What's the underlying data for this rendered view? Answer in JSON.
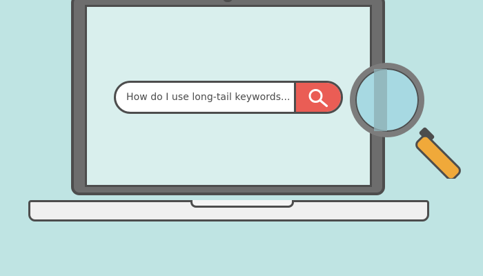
{
  "search": {
    "query_text": "How do I use long-tail keywords...",
    "button_icon": "search-icon"
  },
  "illustration": {
    "objects": [
      "laptop",
      "search bar",
      "magnifying glass"
    ]
  },
  "colors": {
    "background": "#bfe4e3",
    "screen": "#d9efed",
    "laptop_outline": "#4d4d4d",
    "laptop_frame": "#6d6d6d",
    "laptop_base": "#f0f0f0",
    "search_button": "#ea5d55",
    "magnifier_lens": "#a7d9e2",
    "magnifier_handle": "#f0a93a"
  }
}
